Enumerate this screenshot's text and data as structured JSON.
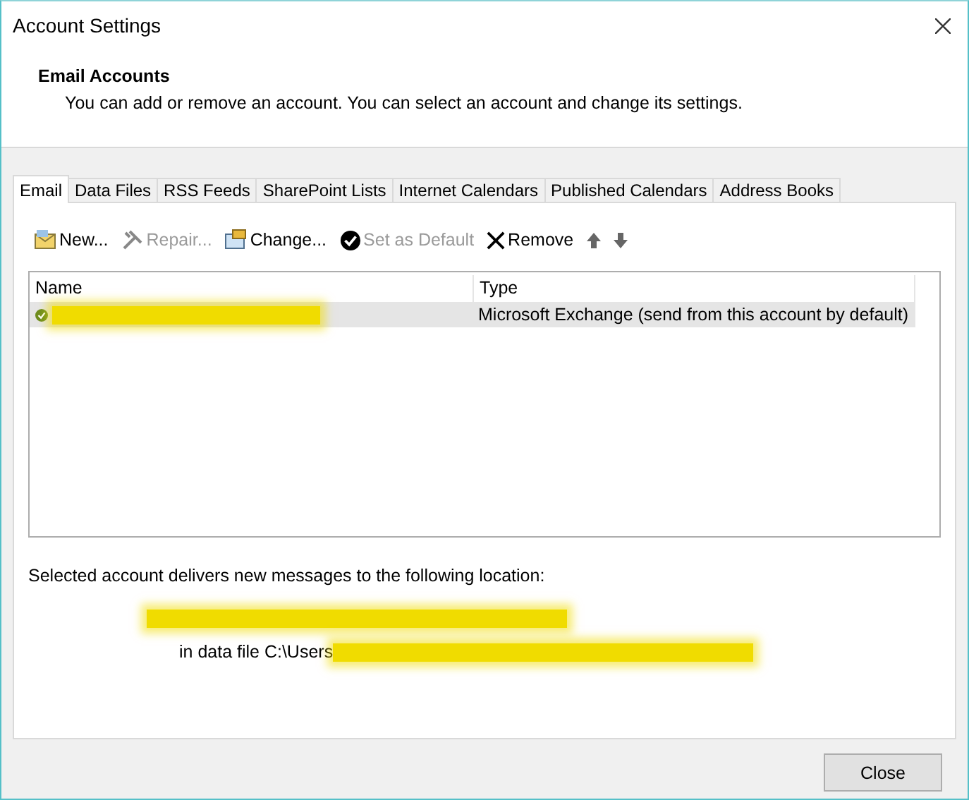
{
  "window": {
    "title": "Account Settings"
  },
  "header": {
    "title": "Email Accounts",
    "description": "You can add or remove an account. You can select an account and change its settings."
  },
  "tabs": [
    {
      "label": "Email",
      "selected": true
    },
    {
      "label": "Data Files",
      "selected": false
    },
    {
      "label": "RSS Feeds",
      "selected": false
    },
    {
      "label": "SharePoint Lists",
      "selected": false
    },
    {
      "label": "Internet Calendars",
      "selected": false
    },
    {
      "label": "Published Calendars",
      "selected": false
    },
    {
      "label": "Address Books",
      "selected": false
    }
  ],
  "toolbar": [
    {
      "kind": "new",
      "label": "New...",
      "disabled": false
    },
    {
      "kind": "repair",
      "label": "Repair...",
      "disabled": true
    },
    {
      "kind": "change",
      "label": "Change...",
      "disabled": false
    },
    {
      "kind": "default",
      "label": "Set as Default",
      "disabled": true
    },
    {
      "kind": "remove",
      "label": "Remove",
      "disabled": false
    },
    {
      "kind": "up",
      "disabled": false
    },
    {
      "kind": "down",
      "disabled": false
    }
  ],
  "accounts": {
    "columns": [
      "Name",
      "Type"
    ],
    "rows": [
      {
        "type": "Microsoft Exchange (send from this account by default)",
        "selected": true,
        "is_default": true
      }
    ]
  },
  "delivery": {
    "text": "Selected account delivers new messages to the following location:",
    "data_file_prefix": "in data file C:\\Users"
  },
  "buttons": [
    "Close"
  ]
}
